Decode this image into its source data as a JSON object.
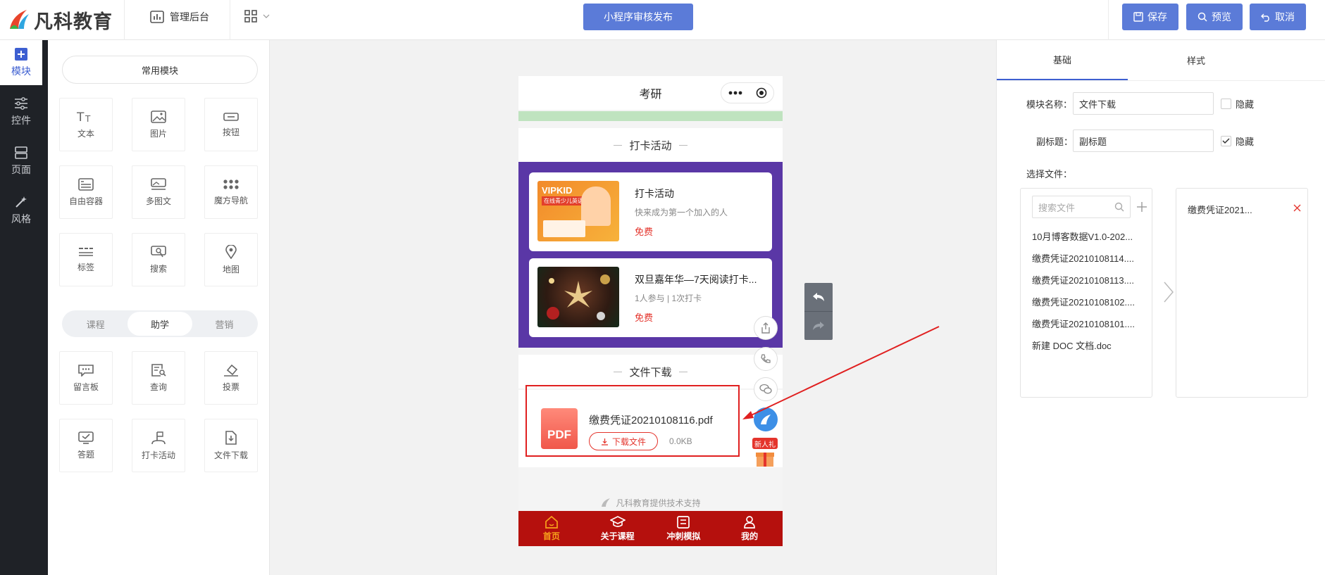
{
  "brand": {
    "name": "凡科教育"
  },
  "topbar": {
    "admin_label": "管理后台",
    "publish_label": "小程序审核发布",
    "save_label": "保存",
    "preview_label": "预览",
    "cancel_label": "取消",
    "accent": "#5b7bd8"
  },
  "leftnav": {
    "items": [
      {
        "label": "模块",
        "icon": "plus-square-icon",
        "active": true
      },
      {
        "label": "控件",
        "icon": "sliders-icon"
      },
      {
        "label": "页面",
        "icon": "page-stack-icon"
      },
      {
        "label": "风格",
        "icon": "magic-wand-icon"
      }
    ]
  },
  "modules": {
    "common_label": "常用模块",
    "common": [
      {
        "label": "文本",
        "icon": "text-icon"
      },
      {
        "label": "图片",
        "icon": "image-icon"
      },
      {
        "label": "按钮",
        "icon": "button-icon"
      },
      {
        "label": "自由容器",
        "icon": "container-icon"
      },
      {
        "label": "多图文",
        "icon": "multi-image-text-icon"
      },
      {
        "label": "魔方导航",
        "icon": "grid-dots-icon"
      },
      {
        "label": "标签",
        "icon": "tabs-icon"
      },
      {
        "label": "搜索",
        "icon": "search-icon"
      },
      {
        "label": "地图",
        "icon": "map-pin-icon"
      }
    ],
    "tabs": [
      "课程",
      "助学",
      "营销"
    ],
    "active_tab": "助学",
    "assist": [
      {
        "label": "留言板",
        "icon": "message-board-icon"
      },
      {
        "label": "查询",
        "icon": "query-icon"
      },
      {
        "label": "投票",
        "icon": "vote-icon"
      },
      {
        "label": "答题",
        "icon": "answer-icon"
      },
      {
        "label": "打卡活动",
        "icon": "checkin-flag-icon"
      },
      {
        "label": "文件下载",
        "icon": "file-download-icon"
      }
    ]
  },
  "phone": {
    "title": "考研",
    "checkin_section": "打卡活动",
    "cards": [
      {
        "title": "打卡活动",
        "sub": "快来成为第一个加入的人",
        "price": "免费",
        "img_text": "VIPKID",
        "img_sub": "在线青少儿英语"
      },
      {
        "title": "双旦嘉年华—7天阅读打卡...",
        "sub": "1人参与 | 1次打卡",
        "price": "免费"
      }
    ],
    "file_section": "文件下载",
    "file": {
      "name": "缴费凭证20210108116.pdf",
      "icon_text": "PDF",
      "download_label": "下载文件",
      "size": "0.0KB"
    },
    "new_gift": "新人礼",
    "footer_tip": "凡科教育提供技术支持",
    "tabbar": [
      {
        "label": "首页",
        "icon": "home-icon",
        "active": true
      },
      {
        "label": "关于课程",
        "icon": "graduation-cap-icon"
      },
      {
        "label": "冲刺模拟",
        "icon": "exam-icon"
      },
      {
        "label": "我的",
        "icon": "user-icon"
      }
    ],
    "tabbar_color": "#b5100d"
  },
  "rightpanel": {
    "tabs": [
      "基础",
      "样式"
    ],
    "active_tab": "基础",
    "module_name_label": "模块名称：",
    "module_name_value": "文件下载",
    "hide_label": "隐藏",
    "subtitle_label": "副标题：",
    "subtitle_value": "副标题",
    "subtitle_hidden": true,
    "select_file_label": "选择文件：",
    "search_placeholder": "搜索文件",
    "files": [
      "10月博客数据V1.0-202...",
      "缴费凭证20210108114....",
      "缴费凭证20210108113....",
      "缴费凭证20210108102....",
      "缴费凭证20210108101....",
      "新建 DOC 文档.doc"
    ],
    "selected_files": [
      "缴费凭证2021..."
    ]
  }
}
